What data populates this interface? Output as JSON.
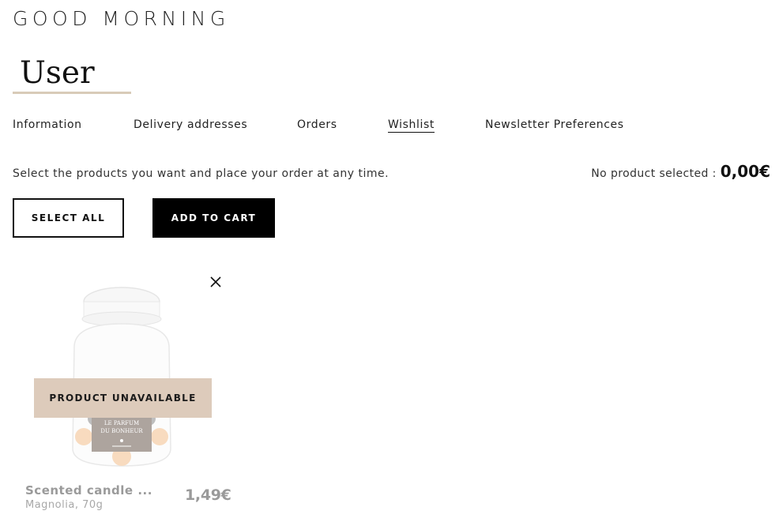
{
  "header": {
    "greeting": "GOOD MORNING",
    "user_name": "User"
  },
  "tabs": [
    {
      "label": "Information",
      "active": false
    },
    {
      "label": "Delivery addresses",
      "active": false
    },
    {
      "label": "Orders",
      "active": false
    },
    {
      "label": "Wishlist",
      "active": true
    },
    {
      "label": "Newsletter Preferences",
      "active": false
    }
  ],
  "wishlist": {
    "intro": "Select the products you want and place your order at any time.",
    "selection_label": "No product selected :",
    "selection_total": "0,00€",
    "select_all_label": "SELECT ALL",
    "add_to_cart_label": "ADD TO CART",
    "items": [
      {
        "name": "Scented candle ...",
        "variant": "Magnolia, 70g",
        "price": "1,49€",
        "status_badge": "PRODUCT UNAVAILABLE",
        "image_label": "LE PARFUM DU BONHEUR",
        "remove_icon": "close-icon"
      }
    ]
  },
  "colors": {
    "accent_underline": "#d8cbb8",
    "badge_background": "#ddcbbb",
    "primary_button": "#000000"
  }
}
